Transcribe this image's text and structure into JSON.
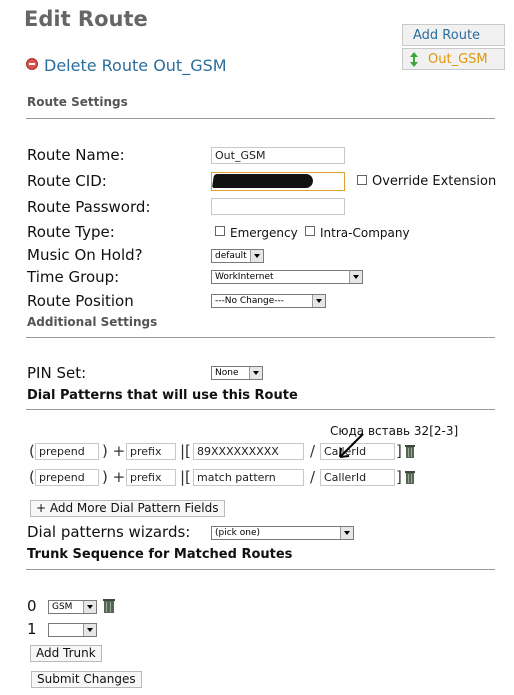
{
  "page": {
    "title": "Edit Route",
    "add_route": "Add Route",
    "current_route": "Out_GSM",
    "delete_link": "Delete Route Out_GSM"
  },
  "sections": {
    "route_settings": "Route Settings",
    "additional_settings": "Additional Settings",
    "dial_patterns": "Dial Patterns that will use this Route",
    "trunk_sequence": "Trunk Sequence for Matched Routes"
  },
  "form": {
    "route_name_label": "Route Name:",
    "route_name_value": "Out_GSM",
    "route_cid_label": "Route CID:",
    "route_cid_value": "89",
    "override_extension": "Override Extension",
    "route_password_label": "Route Password:",
    "route_type_label": "Route Type:",
    "emergency": "Emergency",
    "intra_company": "Intra-Company",
    "moh_label": "Music On Hold?",
    "moh_value": "default",
    "time_group_label": "Time Group:",
    "time_group_value": "WorkInternet",
    "route_position_label": "Route Position",
    "route_position_value": "---No Change---",
    "pin_set_label": "PIN Set:",
    "pin_set_value": "None"
  },
  "annotation": "Сюда вставь 32[2-3]",
  "dial_patterns": [
    {
      "open": "(",
      "prepend": "prepend",
      "mid": ") +",
      "prefix": "prefix",
      "sep": "|[",
      "pattern": "89XXXXXXXXX",
      "slash": "/",
      "callerid": "CallerId",
      "close": "]"
    },
    {
      "open": "(",
      "prepend": "prepend",
      "mid": ") +",
      "prefix": "prefix",
      "sep": "|[",
      "pattern": "match pattern",
      "slash": "/",
      "callerid": "CallerId",
      "close": "]"
    }
  ],
  "buttons": {
    "add_more": "+ Add More Dial Pattern Fields",
    "add_trunk": "Add Trunk",
    "submit": "Submit Changes"
  },
  "wizard": {
    "label": "Dial patterns wizards:",
    "value": "(pick one)"
  },
  "trunks": [
    {
      "index": "0",
      "value": "GSM"
    },
    {
      "index": "1",
      "value": ""
    }
  ]
}
